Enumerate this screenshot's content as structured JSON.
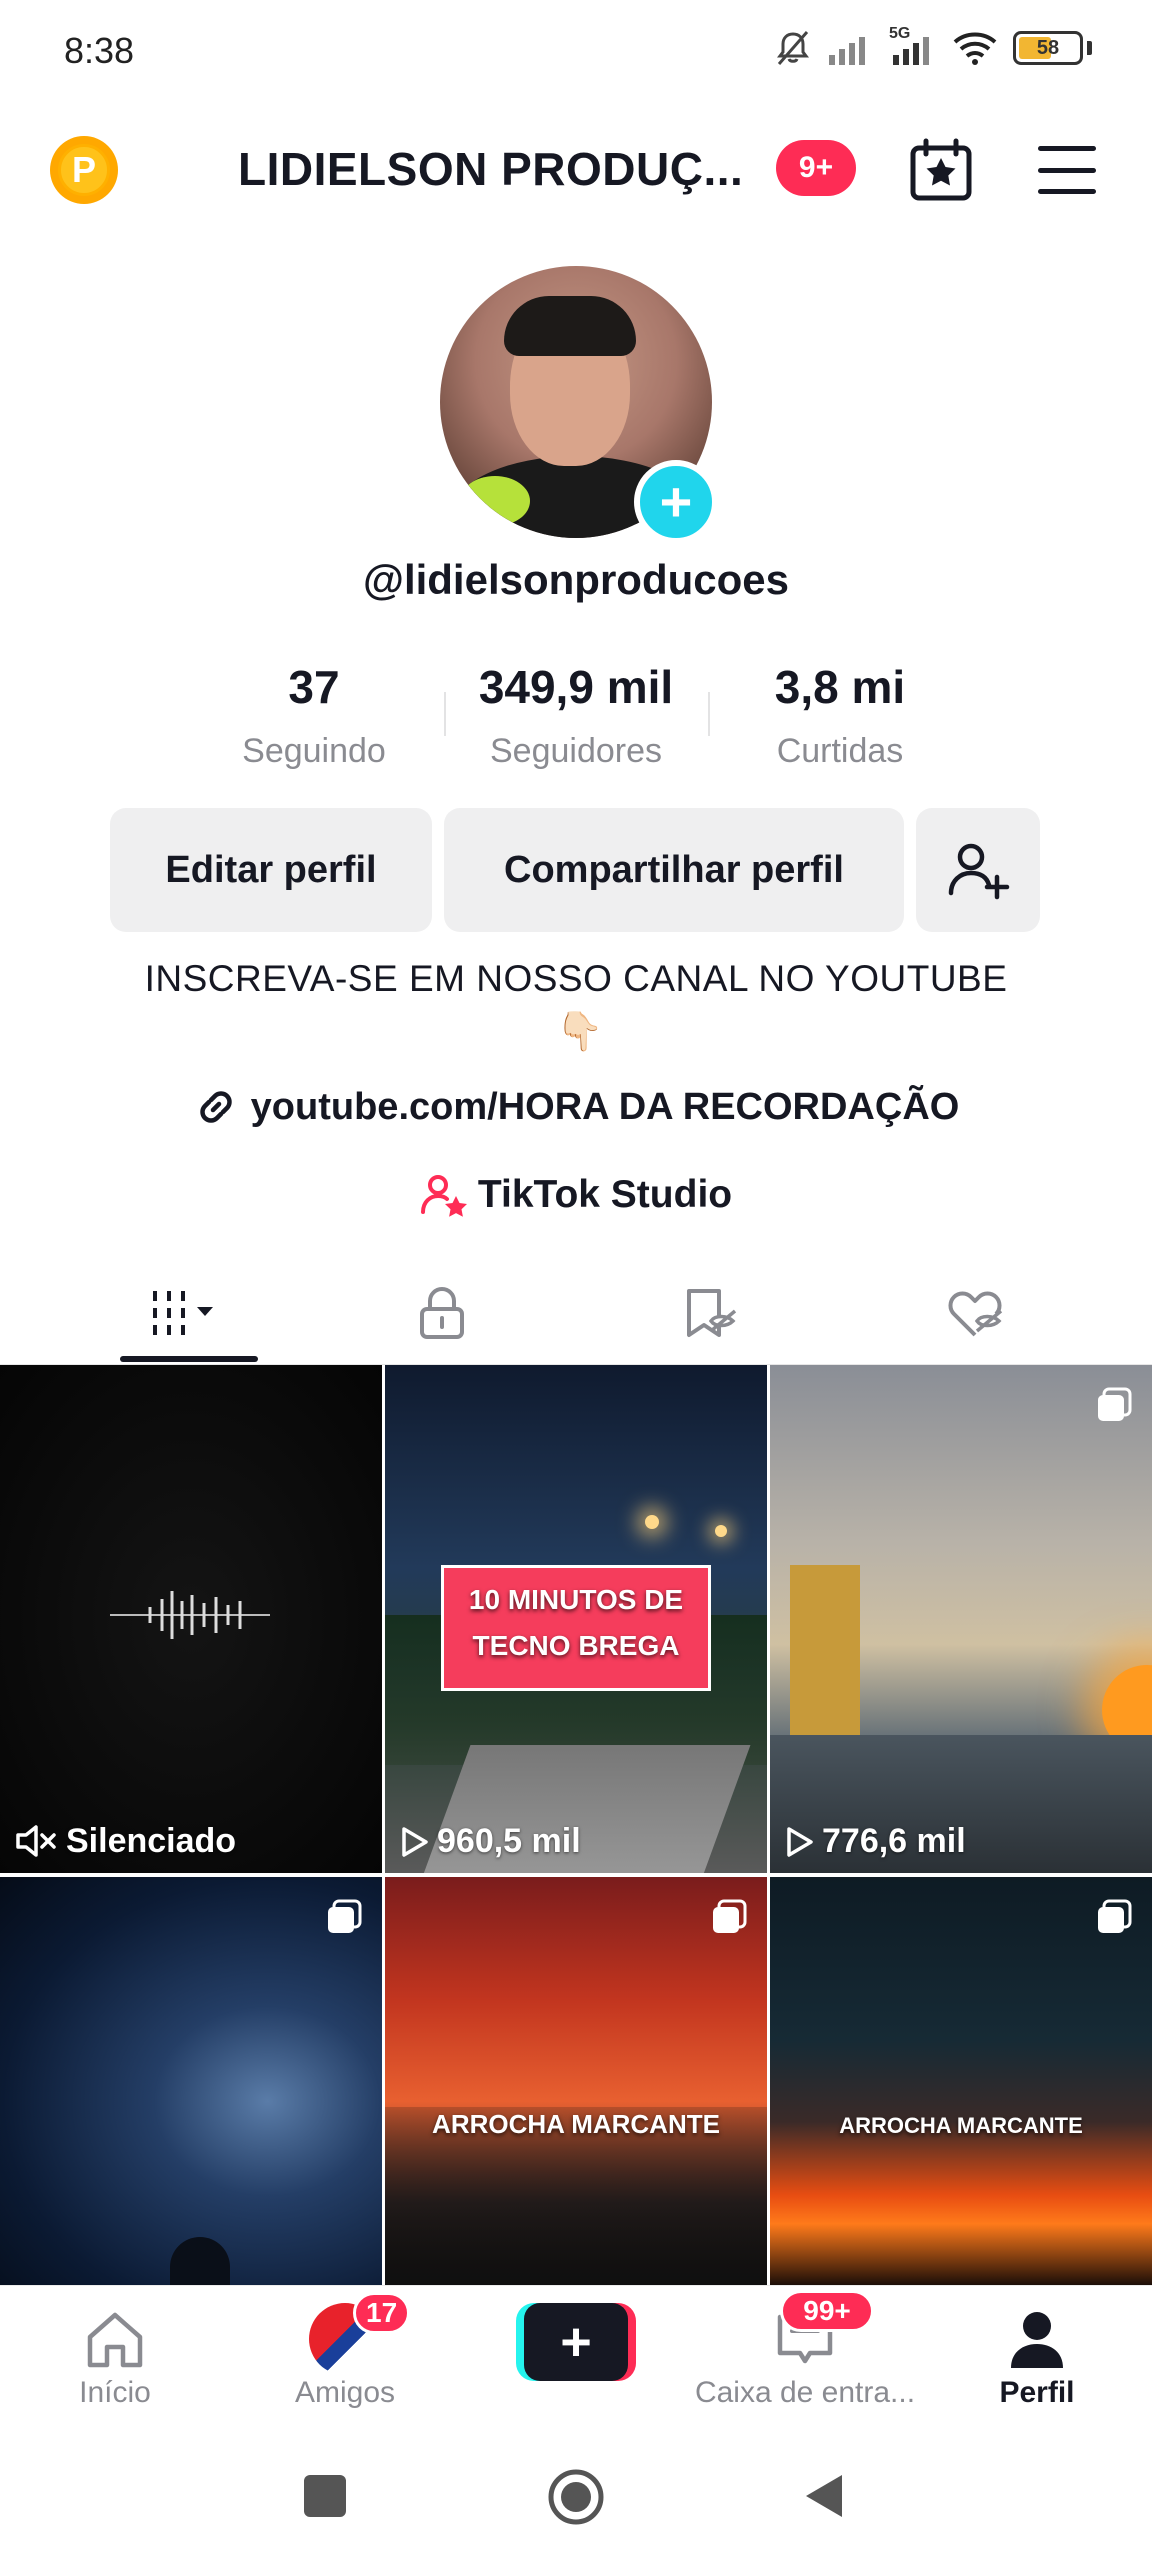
{
  "status_bar": {
    "time": "8:38",
    "network": "5G",
    "battery": "58"
  },
  "header": {
    "coin_letter": "P",
    "title": "LIDIELSON PRODUÇ...",
    "notification_count": "9+"
  },
  "profile": {
    "username": "@lidielsonproducoes",
    "stats": [
      {
        "value": "37",
        "label": "Seguindo"
      },
      {
        "value": "349,9 mil",
        "label": "Seguidores"
      },
      {
        "value": "3,8 mi",
        "label": "Curtidas"
      }
    ],
    "edit_label": "Editar perfil",
    "share_label": "Compartilhar perfil",
    "bio": "INSCREVA-SE EM NOSSO CANAL NO YOUTUBE",
    "bio_emoji": "👇🏻",
    "link": "youtube.com/HORA DA RECORDAÇÃO",
    "studio": "TikTok Studio"
  },
  "tabs": [
    "videos",
    "private",
    "reposts",
    "liked"
  ],
  "videos": [
    {
      "views": "Silenciado",
      "overlay": ""
    },
    {
      "views": "960,5 mil",
      "overlay_line1": "10 MINUTOS DE",
      "overlay_line2": "TECNO BREGA"
    },
    {
      "views": "776,6 mil",
      "overlay": ""
    },
    {
      "views": "",
      "overlay": ""
    },
    {
      "views": "",
      "overlay": "ARROCHA MARCANTE"
    },
    {
      "views": "",
      "overlay": "ARROCHA MARCANTE"
    }
  ],
  "bottom_nav": [
    {
      "label": "Início",
      "badge": ""
    },
    {
      "label": "Amigos",
      "badge": "17"
    },
    {
      "label": "",
      "badge": ""
    },
    {
      "label": "Caixa de entra...",
      "badge": "99+"
    },
    {
      "label": "Perfil",
      "badge": ""
    }
  ],
  "colors": {
    "accent": "#fe2c55",
    "teal": "#20d5ec"
  }
}
